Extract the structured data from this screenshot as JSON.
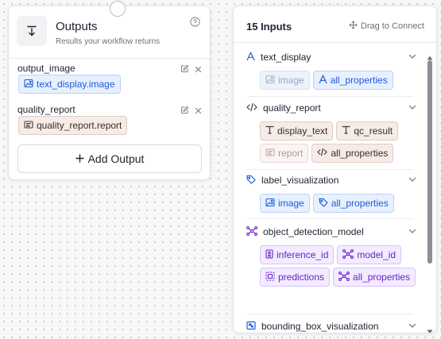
{
  "outputs": {
    "title": "Outputs",
    "subtitle": "Results your workflow returns",
    "items": [
      {
        "name": "output_image",
        "value": "text_display.image"
      },
      {
        "name": "quality_report",
        "value": "quality_report.report"
      }
    ],
    "add_label": "Add Output"
  },
  "inputs": {
    "title": "15 Inputs",
    "drag_hint": "Drag to Connect",
    "sections": [
      {
        "name": "text_display",
        "chips": [
          "image",
          "all_properties"
        ]
      },
      {
        "name": "quality_report",
        "chips": [
          "display_text",
          "qc_result",
          "report",
          "all_properties"
        ]
      },
      {
        "name": "label_visualization",
        "chips": [
          "image",
          "all_properties"
        ]
      },
      {
        "name": "object_detection_model",
        "chips": [
          "inference_id",
          "model_id",
          "predictions",
          "all_properties"
        ]
      },
      {
        "name": "bounding_box_visualization",
        "chips": []
      }
    ]
  },
  "colors": {
    "blue_chip": "#e7f0ff",
    "tan_chip": "#f5ebe7",
    "purple_chip": "#f3ebff",
    "accent_blue": "#1f5bd8",
    "accent_purple": "#6a22c9"
  }
}
